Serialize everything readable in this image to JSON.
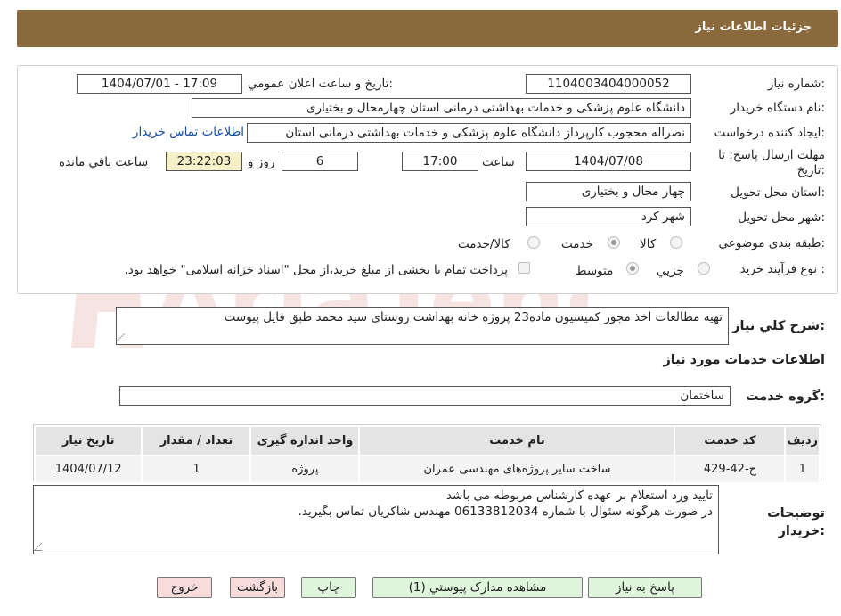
{
  "header": {
    "title": "جزئیات اطلاعات نیاز"
  },
  "fields": {
    "need_number_label": "شماره نیاز:",
    "need_number": "1104003404000052",
    "announce_label": "تاریخ و ساعت اعلان عمومي:",
    "announce_value": "1404/07/01 - 17:09",
    "buyer_org_label": "نام دستگاه خريدار:",
    "buyer_org": "دانشگاه علوم پزشکی و خدمات بهداشتی درمانی استان چهارمحال و بختیاری",
    "creator_label": "ايجاد کننده درخواست:",
    "creator": "نصراله محجوب کارپرداز دانشگاه علوم پزشکی و خدمات بهداشتی درمانی استان",
    "contact_link": "اطلاعات تماس خريدار",
    "deadline_label": "مهلت ارسال پاسخ: تا تاریخ:",
    "deadline_date": "1404/07/08",
    "time_label": "ساعت",
    "deadline_time": "17:00",
    "days": "6",
    "days_label": "روز و",
    "remaining": "23:22:03",
    "remaining_label": "ساعت باقي مانده",
    "province_label": "استان محل تحويل:",
    "province": "چهار محال و بختیاری",
    "city_label": "شهر محل تحويل:",
    "city": "شهر کرد",
    "category_label": "طبقه بندی موضوعی:",
    "category_options": [
      "کالا",
      "خدمت",
      "کالا/خدمت"
    ],
    "process_label": "نوع فرآيند خريد :",
    "process_options": [
      "جزيي",
      "متوسط"
    ],
    "payment_note": "پرداخت تمام یا بخشی از مبلغ خرید،از محل \"اسناد خزانه اسلامی\" خواهد بود."
  },
  "description": {
    "label": "شرح کلي نياز:",
    "text": "تهیه مطالعات اخذ مجوز کمیسیون ماده23 پروژه خانه بهداشت روستای سید محمد طبق فایل پیوست"
  },
  "services": {
    "section_title": "اطلاعات خدمات مورد نياز",
    "group_label": "گروه خدمت:",
    "group_value": "ساختمان",
    "columns": [
      "رديف",
      "کد خدمت",
      "نام خدمت",
      "واحد اندازه گيری",
      "تعداد / مقدار",
      "تاریخ نیاز"
    ],
    "rows": [
      {
        "row": "1",
        "code": "ج-42-429",
        "name": "ساخت سایر پروژه‌های مهندسی عمران",
        "unit": "پروژه",
        "qty": "1",
        "date": "1404/07/12"
      }
    ]
  },
  "buyer_notes": {
    "label": "توضيحات خريدار:",
    "line1": "تایید ورد استعلام بر عهده کارشناس مربوطه می باشد",
    "line2": "در صورت هرگونه سئوال با شماره 06133812034 مهندس شاکریان تماس بگیرید."
  },
  "buttons": {
    "respond": "پاسخ به نياز",
    "attachments": "مشاهده مدارک پيوستي (1)",
    "print": "چاپ",
    "back": "بازگشت",
    "exit": "خروج"
  },
  "watermark": {
    "text": "AriaTender.neT"
  },
  "colors": {
    "header_bg": "#8a6a3c",
    "link": "#1a4ea6",
    "yellow_box": "#f6f0c8",
    "green_btn": "#dff5dc",
    "pink_btn": "#f8dcdc"
  }
}
